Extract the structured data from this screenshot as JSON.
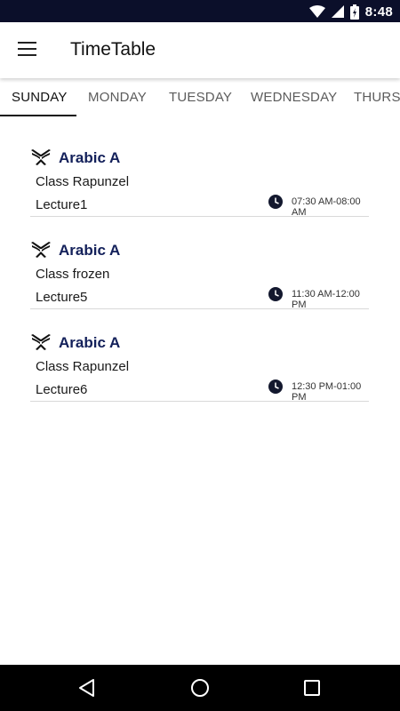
{
  "status_bar": {
    "time": "8:48",
    "icons": [
      "wifi-icon",
      "signal-icon",
      "battery-icon"
    ]
  },
  "app_bar": {
    "title": "TimeTable",
    "menu_icon": "hamburger-menu-icon"
  },
  "tabs": [
    {
      "label": "SUNDAY",
      "active": true
    },
    {
      "label": "MONDAY",
      "active": false
    },
    {
      "label": "TUESDAY",
      "active": false
    },
    {
      "label": "WEDNESDAY",
      "active": false
    },
    {
      "label": "THURSDAY",
      "active": false
    }
  ],
  "lectures": [
    {
      "subject": "Arabic A",
      "class_name": "Class Rapunzel",
      "lecture": "Lecture1",
      "time": "07:30 AM-08:00 AM"
    },
    {
      "subject": "Arabic A",
      "class_name": "Class frozen",
      "lecture": "Lecture5",
      "time": "11:30 AM-12:00 PM"
    },
    {
      "subject": "Arabic A",
      "class_name": "Class Rapunzel",
      "lecture": "Lecture6",
      "time": "12:30 PM-01:00 PM"
    }
  ],
  "nav_bar": {
    "buttons": [
      "back-icon",
      "home-icon",
      "recents-icon"
    ]
  },
  "colors": {
    "status_bar": "#0b0f2a",
    "subject_text": "#13205a",
    "divider": "#d9d9d9"
  }
}
